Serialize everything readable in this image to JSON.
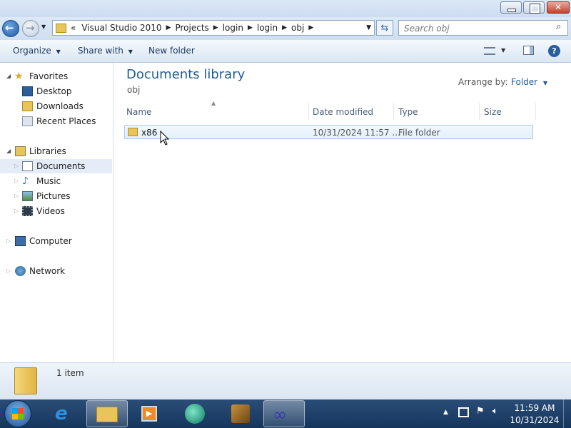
{
  "address": {
    "overflow": "«",
    "crumbs": [
      "Visual Studio 2010",
      "Projects",
      "login",
      "login",
      "obj"
    ]
  },
  "search": {
    "placeholder": "Search obj"
  },
  "toolbar": {
    "organize": "Organize",
    "share_with": "Share with",
    "new_folder": "New folder"
  },
  "nav": {
    "favorites": "Favorites",
    "desktop": "Desktop",
    "downloads": "Downloads",
    "recent": "Recent Places",
    "libraries": "Libraries",
    "documents": "Documents",
    "music": "Music",
    "pictures": "Pictures",
    "videos": "Videos",
    "computer": "Computer",
    "network": "Network"
  },
  "library": {
    "title": "Documents library",
    "subtitle": "obj",
    "arrange_label": "Arrange by:",
    "arrange_value": "Folder"
  },
  "columns": {
    "name": "Name",
    "date": "Date modified",
    "type": "Type",
    "size": "Size"
  },
  "files": [
    {
      "name": "x86",
      "date": "10/31/2024 11:57 ...",
      "type": "File folder",
      "size": ""
    }
  ],
  "status": {
    "count": "1 item"
  },
  "clock": {
    "time": "11:59 AM",
    "date": "10/31/2024"
  },
  "colors": {
    "accent": "#1e5c9b",
    "selection": "#e5f0fb",
    "taskbar": "#1d3f68"
  }
}
